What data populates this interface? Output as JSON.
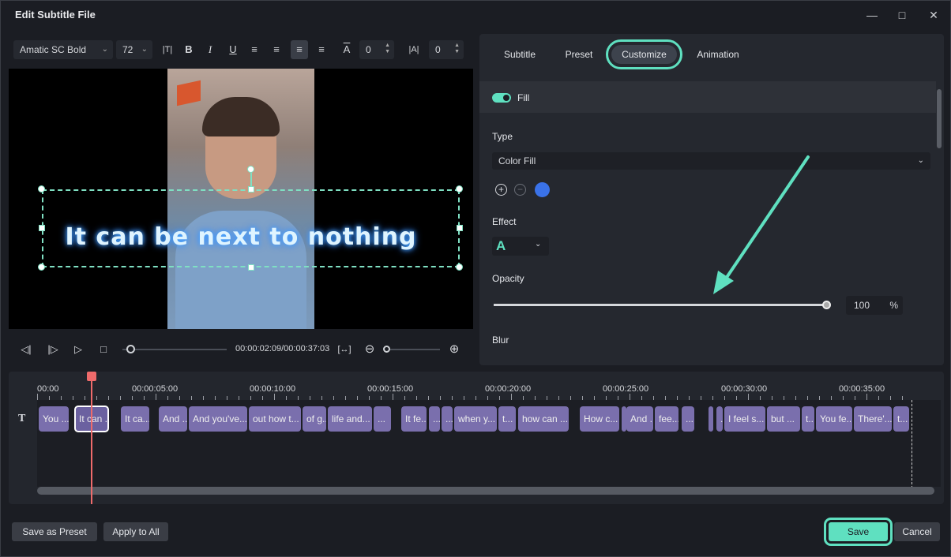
{
  "window": {
    "title": "Edit Subtitle File",
    "controls": [
      "minimize",
      "maximize",
      "close"
    ]
  },
  "toolbar": {
    "font": "Amatic SC Bold",
    "size": "72",
    "spacing_value": "0",
    "line_height_value": "0"
  },
  "preview": {
    "subtitle_text": "It can be next to nothing"
  },
  "playback": {
    "timecode": "00:00:02:09/00:00:37:03"
  },
  "tabs": [
    {
      "label": "Subtitle"
    },
    {
      "label": "Preset"
    },
    {
      "label": "Customize"
    },
    {
      "label": "Animation"
    }
  ],
  "customize": {
    "fill_label": "Fill",
    "type_label": "Type",
    "type_value": "Color Fill",
    "fill_color": "#3a72e8",
    "effect_label": "Effect",
    "effect_glyph": "A",
    "opacity_label": "Opacity",
    "opacity_value": "100",
    "opacity_unit": "%",
    "blur_label": "Blur"
  },
  "timeline": {
    "ticks": [
      "00:00",
      "00:00:05:00",
      "00:00:10:00",
      "00:00:15:00",
      "00:00:20:00",
      "00:00:25:00",
      "00:00:30:00",
      "00:00:35:00"
    ],
    "clips": [
      "You ...",
      "It can ...",
      "It ca...",
      "And ...",
      "And you've...",
      "out how t...",
      "of g...",
      "life and...",
      "...",
      "It fe...",
      "...",
      "...",
      "when y...",
      "t...",
      "how can ...",
      "How c...",
      "...",
      "And ...",
      "fee...",
      "...",
      "...",
      "...",
      "I feel s...",
      "but ...",
      "t...",
      "You fe...",
      "There'...",
      "t..."
    ]
  },
  "footer": {
    "save_preset": "Save as Preset",
    "apply_all": "Apply to All",
    "save": "Save",
    "cancel": "Cancel"
  },
  "colors": {
    "accent": "#5fe0c0",
    "clip": "#7a6fad",
    "playhead": "#ef6b6b"
  }
}
